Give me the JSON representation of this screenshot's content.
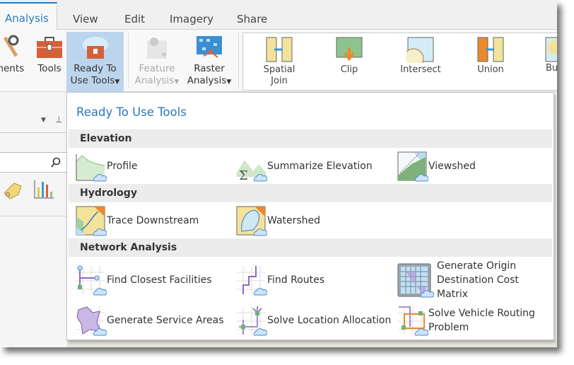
{
  "tabs": [
    {
      "label": "Analysis",
      "active": true
    },
    {
      "label": "View"
    },
    {
      "label": "Edit"
    },
    {
      "label": "Imagery"
    },
    {
      "label": "Share"
    }
  ],
  "ribbon": {
    "environments_partial": "ments",
    "tools": "Tools",
    "ready_to_use": [
      "Ready To",
      "Use Tools"
    ],
    "feature_analysis": [
      "Feature",
      "Analysis"
    ],
    "raster_analysis": [
      "Raster",
      "Analysis"
    ],
    "gallery": [
      {
        "label": [
          "Spatial",
          "Join"
        ]
      },
      {
        "label": [
          "Clip"
        ]
      },
      {
        "label": [
          "Intersect"
        ]
      },
      {
        "label": [
          "Union"
        ]
      },
      {
        "label": [
          "Bu"
        ]
      }
    ]
  },
  "dropdown": {
    "title": "Ready To Use Tools",
    "sections": [
      {
        "name": "Elevation",
        "items": [
          "Profile",
          "Summarize Elevation",
          "Viewshed"
        ]
      },
      {
        "name": "Hydrology",
        "items": [
          "Trace Downstream",
          "Watershed"
        ]
      },
      {
        "name": "Network Analysis",
        "items": [
          "Find Closest Facilities",
          "Find Routes",
          "Generate Origin Destination Cost Matrix",
          "Generate Service Areas",
          "Solve Location Allocation",
          "Solve Vehicle Routing Problem"
        ]
      }
    ]
  },
  "colors": {
    "accent": "#2a7bc0",
    "selected": "#bcd5ec",
    "cloud": "#cfe2f7"
  }
}
